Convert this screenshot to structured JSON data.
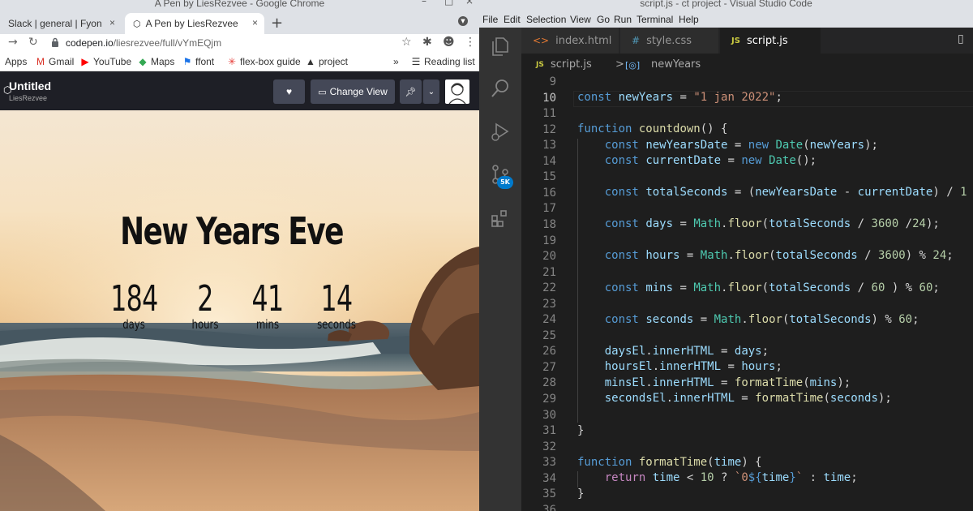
{
  "chrome": {
    "window_title": "A Pen by LiesRezvee - Google Chrome",
    "tabs": [
      {
        "label": "Slack | general | Fyon"
      },
      {
        "label": "A Pen by LiesRezvee"
      }
    ],
    "url_host": "codepen.io",
    "url_path": "/liesrezvee/full/vYmEQjm",
    "bookmarks": [
      {
        "label": "Apps",
        "icon": "apps-grid-icon"
      },
      {
        "label": "Gmail",
        "icon": "gmail-icon"
      },
      {
        "label": "YouTube",
        "icon": "youtube-icon"
      },
      {
        "label": "Maps",
        "icon": "maps-icon"
      },
      {
        "label": "ffont",
        "icon": "flag-icon"
      },
      {
        "label": "flex-box guide",
        "icon": "star-burst-icon"
      },
      {
        "label": "project",
        "icon": "triangle-icon"
      }
    ],
    "reading_list": "Reading list",
    "overflow": "»"
  },
  "codepen": {
    "title": "Untitled",
    "author": "LiesRezvee",
    "change_view": "Change View"
  },
  "page": {
    "headline": "New Years Eve",
    "countdown": [
      {
        "value": "184",
        "label": "days"
      },
      {
        "value": "2",
        "label": "hours"
      },
      {
        "value": "41",
        "label": "mins"
      },
      {
        "value": "14",
        "label": "seconds"
      }
    ]
  },
  "vscode": {
    "window_title": "script.js - ct project - Visual Studio Code",
    "menu": [
      "File",
      "Edit",
      "Selection",
      "View",
      "Go",
      "Run",
      "Terminal",
      "Help"
    ],
    "scm_badge": "5K",
    "tabs": [
      {
        "label": "index.html",
        "icon": "<>",
        "active": false
      },
      {
        "label": "style.css",
        "icon": "#",
        "active": false
      },
      {
        "label": "script.js",
        "icon": "JS",
        "active": true
      }
    ],
    "breadcrumb": {
      "file": "script.js",
      "separator": ">",
      "symbol": "newYears"
    },
    "line_numbers": [
      "9",
      "10",
      "11",
      "12",
      "13",
      "14",
      "15",
      "16",
      "17",
      "18",
      "19",
      "20",
      "21",
      "22",
      "23",
      "24",
      "25",
      "26",
      "27",
      "28",
      "29",
      "30",
      "31",
      "32",
      "33",
      "34",
      "35",
      "36"
    ],
    "current_line": "10"
  },
  "colors": {
    "chrome_frame": "#dee1e6",
    "codepen_header": "#1e1f26",
    "vscode_bg": "#1e1e1e",
    "keyword": "#569cd6",
    "variable": "#9cdcfe",
    "function": "#dcdcaa",
    "string": "#ce9178",
    "number": "#b5cea8"
  }
}
